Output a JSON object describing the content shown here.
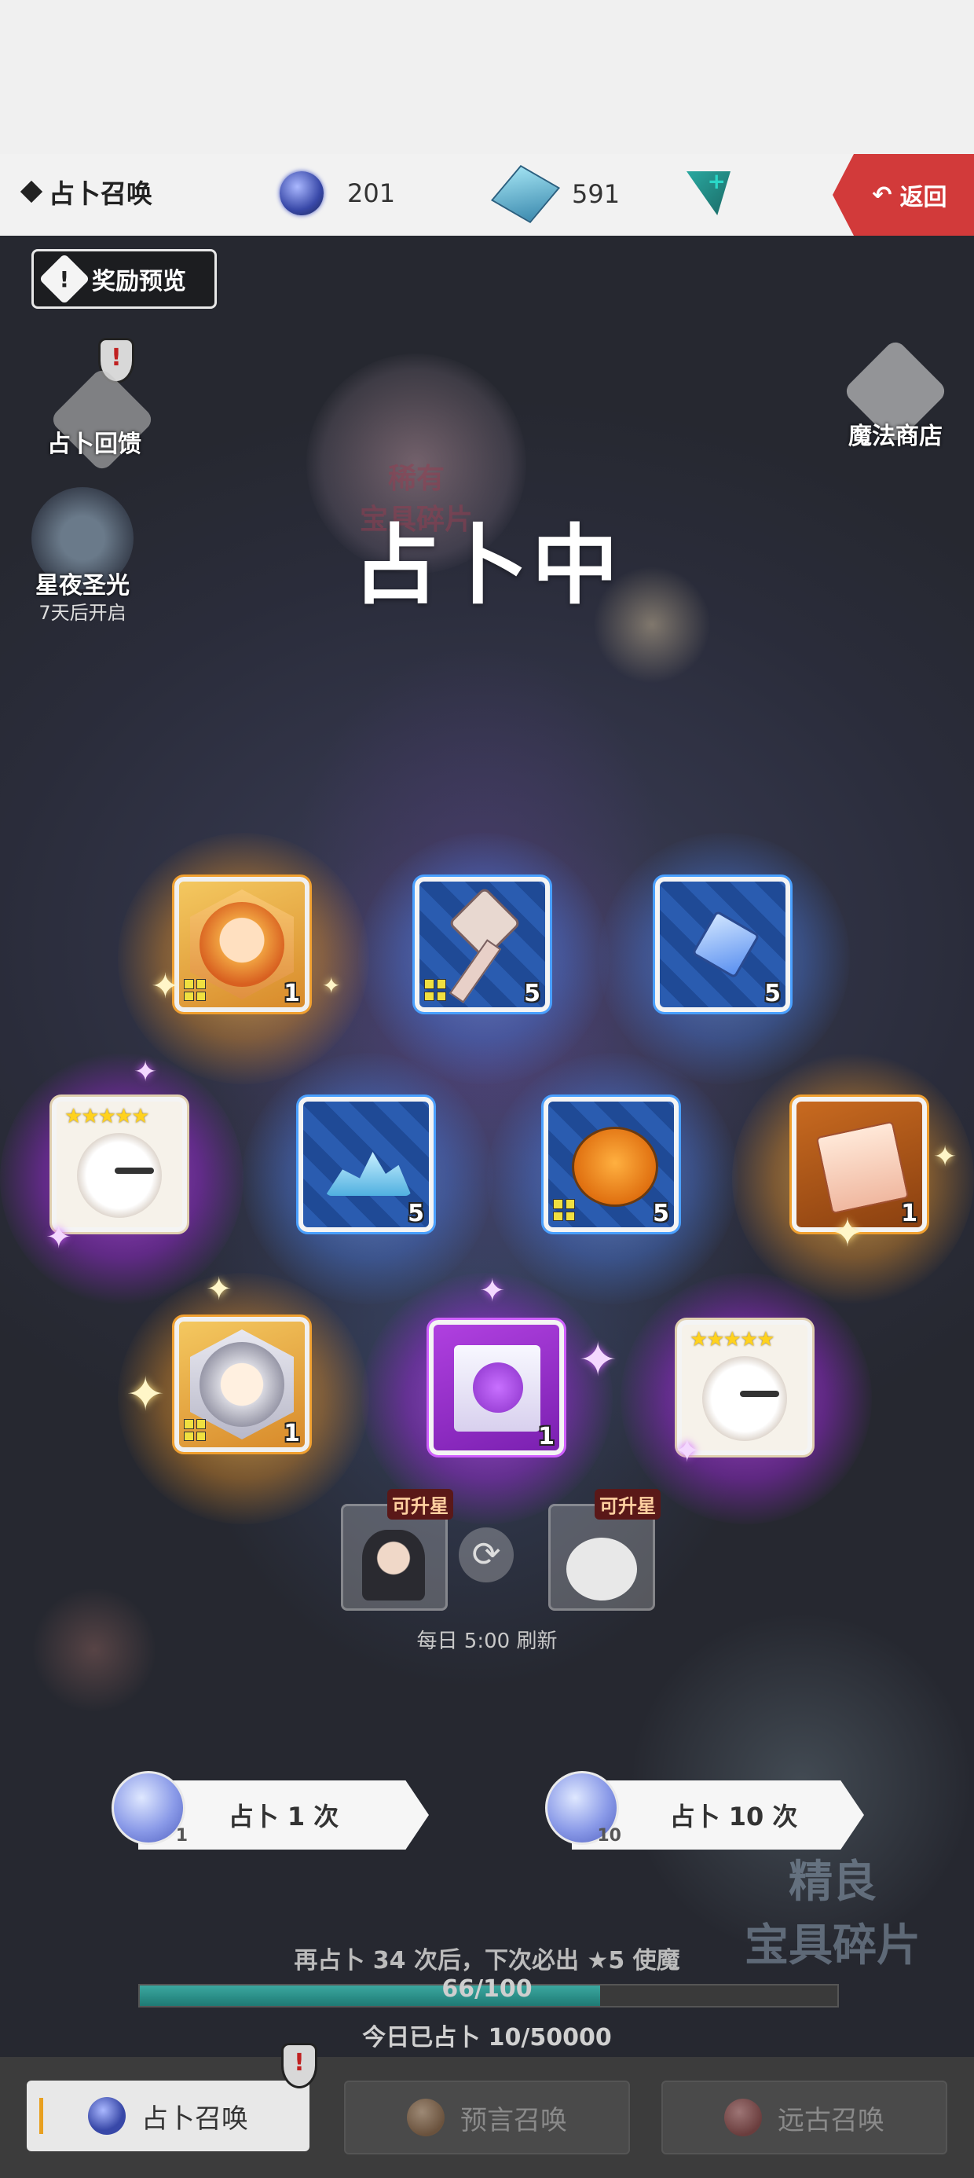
{
  "header": {
    "title": "占卜召唤",
    "orb_count": "201",
    "gem_count": "591",
    "back_label": "返回"
  },
  "scene": {
    "reward_preview": "奖励预览",
    "left_features": [
      {
        "label": "占卜回馈"
      },
      {
        "label": "星夜圣光",
        "sub": "7天后开启"
      }
    ],
    "right_features": [
      {
        "label": "魔法商店"
      }
    ],
    "status_text": "占卜中",
    "rare_fragment_label": "稀有\n宝具碎片",
    "elite_fragment_label": "精良\n宝具碎片"
  },
  "results": [
    {
      "rarity": "gold",
      "kind": "hero-shard",
      "count": "1"
    },
    {
      "rarity": "blue",
      "kind": "scepter",
      "count": "5"
    },
    {
      "rarity": "blue",
      "kind": "crystal",
      "count": "5"
    },
    {
      "rarity": "purple",
      "kind": "bunny-5star",
      "stars": "★★★★★"
    },
    {
      "rarity": "blue",
      "kind": "slime",
      "count": "5"
    },
    {
      "rarity": "blue",
      "kind": "pumpkin",
      "count": "5"
    },
    {
      "rarity": "orange",
      "kind": "scroll",
      "count": "1"
    },
    {
      "rarity": "gold",
      "kind": "hero-shard-silver",
      "count": "1"
    },
    {
      "rarity": "purple",
      "kind": "map",
      "count": "1"
    },
    {
      "rarity": "purple",
      "kind": "bunny-5star",
      "stars": "★★★★★"
    }
  ],
  "upgradable": {
    "badge": "可升星",
    "refresh_text": "每日 5:00 刷新"
  },
  "draw": {
    "single_label": "占卜 1 次",
    "single_count": "1",
    "multi_label": "占卜 10 次",
    "multi_count": "10"
  },
  "progress": {
    "pity_text": "再占卜 34 次后，下次必出 ★5 使魔",
    "value": 66,
    "max": 100,
    "label": "66/100",
    "today_text": "今日已占卜 10/50000"
  },
  "tabs": [
    {
      "label": "占卜召唤",
      "active": true
    },
    {
      "label": "预言召唤",
      "active": false
    },
    {
      "label": "远古召唤",
      "active": false
    }
  ],
  "colors": {
    "accent_red": "#d23a3a",
    "progress_teal": "#1f7a74",
    "gold_glow": "#f0a030",
    "blue_glow": "#4aa0ff",
    "purple_glow": "#d060ff"
  }
}
